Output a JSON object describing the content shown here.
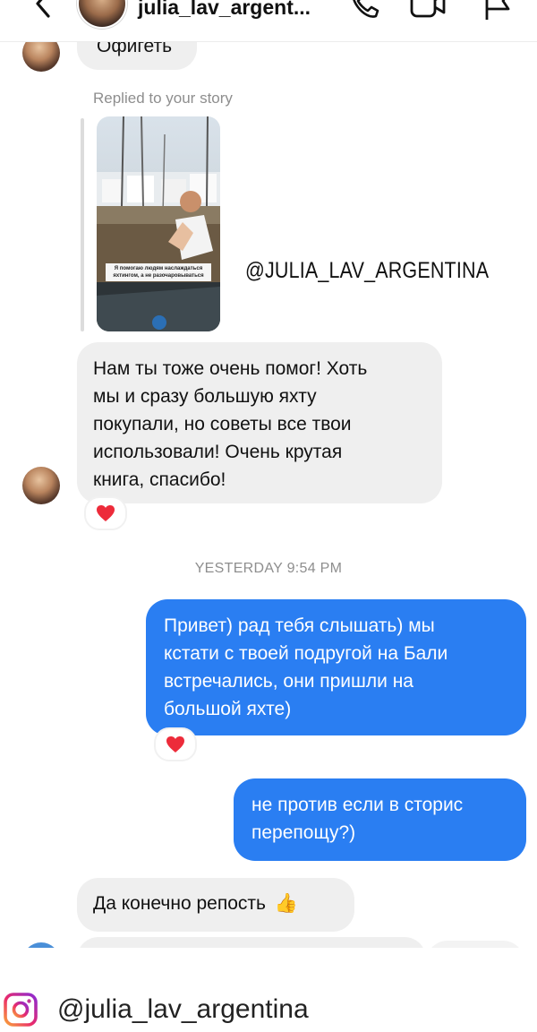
{
  "header": {
    "title": "julia_lav_argent..."
  },
  "messages": {
    "first_partial": "Офигеть",
    "replied_label": "Replied to your story",
    "story": {
      "caption": "Я помогаю людям наслаждаться яхтингом, а не разочаровываться",
      "handle": "@JULIA_LAV_ARGENTINA"
    },
    "incoming_1": {
      "lines": [
        "Нам ты тоже очень помог! Хоть",
        "мы и сразу большую яхту",
        "покупали, но советы все твои",
        "использовали! Очень крутая",
        "книга, спасибо!"
      ],
      "reaction": "❤️"
    },
    "timestamp": "YESTERDAY 9:54 PM",
    "outgoing_1": {
      "lines": [
        "Привет) рад тебя слышать) мы",
        "кстати с твоей подругой на Бали",
        "встречались, они пришли на",
        "большой яхте)"
      ],
      "reaction": "❤️"
    },
    "outgoing_2": {
      "lines": [
        "не против если в сторис",
        "перепощу?)"
      ]
    },
    "incoming_2": {
      "text": "Да конечно репость",
      "emoji": "👍"
    }
  },
  "footer": {
    "handle": "@julia_lav_argentina"
  },
  "colors": {
    "outgoing_bubble": "#2a7ef2",
    "incoming_bubble": "#efefef",
    "meta_text": "#8e8e8e"
  }
}
